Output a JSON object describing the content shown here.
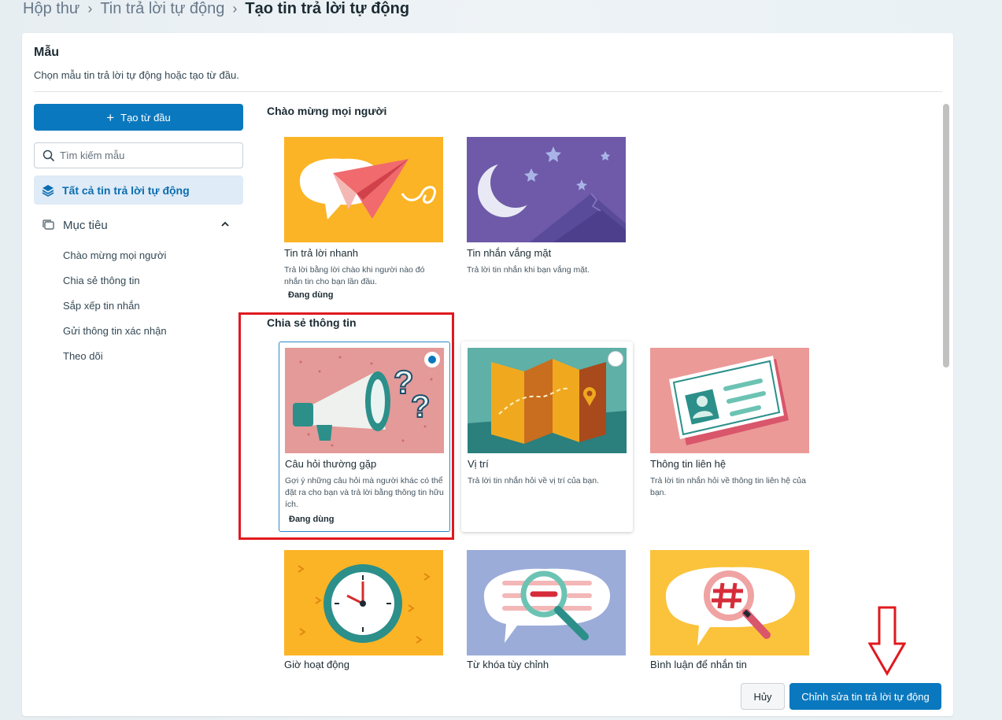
{
  "breadcrumb": {
    "items": [
      "Hộp thư",
      "Tin trả lời tự động"
    ],
    "current": "Tạo tin trả lời tự động"
  },
  "panel": {
    "title": "Mẫu",
    "subtitle": "Chọn mẫu tin trả lời tự động hoặc tạo từ đầu."
  },
  "sidebar": {
    "create_button": "Tạo từ đầu",
    "search_placeholder": "Tìm kiếm mẫu",
    "all_label": "Tất cả tin trả lời tự động",
    "goal_label": "Mục tiêu",
    "goal_items": [
      "Chào mừng mọi người",
      "Chia sẻ thông tin",
      "Sắp xếp tin nhắn",
      "Gửi thông tin xác nhận",
      "Theo dõi"
    ]
  },
  "sections": [
    {
      "title": "Chào mừng mọi người",
      "cards": [
        {
          "name": "Tin trả lời nhanh",
          "desc": "Trả lời bằng lời chào khi người nào đó nhắn tin cho bạn lần đầu.",
          "badge": "Đang dùng",
          "icon": "paper-plane-illustration"
        },
        {
          "name": "Tin nhắn vắng mặt",
          "desc": "Trả lời tin nhắn khi bạn vắng mặt.",
          "badge": "",
          "icon": "moon-illustration"
        }
      ]
    },
    {
      "title": "Chia sẻ thông tin",
      "cards": [
        {
          "name": "Câu hỏi thường gặp",
          "desc": "Gợi ý những câu hỏi mà người khác có thể đặt ra cho bạn và trả lời bằng thông tin hữu ích.",
          "badge": "Đang dùng",
          "icon": "megaphone-illustration"
        },
        {
          "name": "Vị trí",
          "desc": "Trả lời tin nhắn hỏi về vị trí của bạn.",
          "badge": "",
          "icon": "map-illustration"
        },
        {
          "name": "Thông tin liên hệ",
          "desc": "Trả lời tin nhắn hỏi về thông tin liên hệ của bạn.",
          "badge": "",
          "icon": "contact-card-illustration"
        },
        {
          "name": "Giờ hoạt động",
          "desc": "",
          "badge": "",
          "icon": "clock-illustration"
        },
        {
          "name": "Từ khóa tùy chỉnh",
          "desc": "",
          "badge": "",
          "icon": "magnifier-illustration"
        },
        {
          "name": "Bình luận để nhắn tin",
          "desc": "",
          "badge": "",
          "icon": "hashtag-illustration"
        }
      ]
    }
  ],
  "footer": {
    "cancel": "Hủy",
    "edit": "Chỉnh sửa tin trả lời tự động"
  },
  "colors": {
    "primary": "#0a78be",
    "highlight_box": "#e0191e",
    "nav_active_bg": "#dfebf6"
  }
}
